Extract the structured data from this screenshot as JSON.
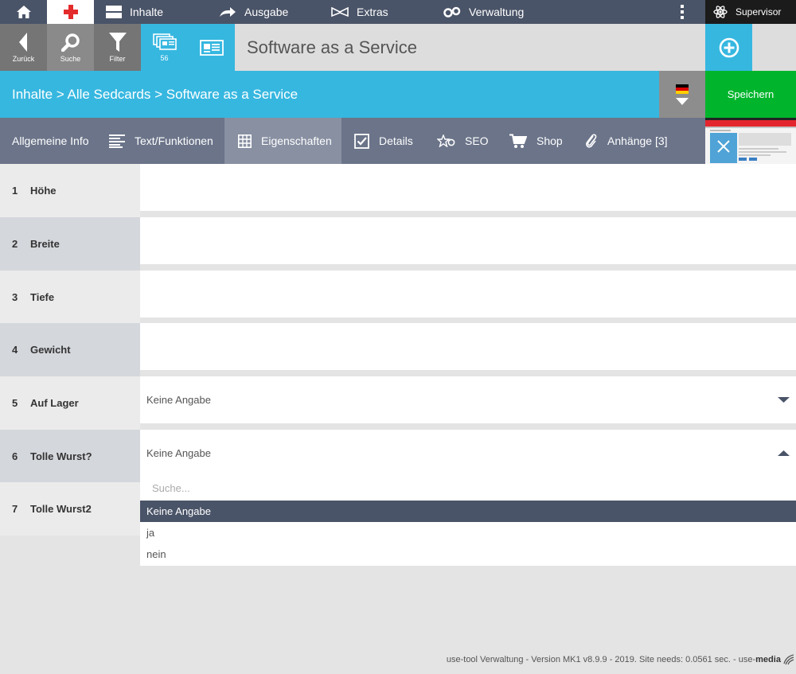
{
  "topnav": {
    "items": [
      {
        "label": "Inhalte",
        "icon": "content-icon"
      },
      {
        "label": "Ausgabe",
        "icon": "arrow-forward-icon"
      },
      {
        "label": "Extras",
        "icon": "extras-icon"
      },
      {
        "label": "Verwaltung",
        "icon": "gears-icon"
      }
    ],
    "user": "Supervisor"
  },
  "toolbar": {
    "back_caption": "Zurück",
    "search_caption": "Suche",
    "filter_caption": "Filter",
    "stack_count": "56",
    "title": "Software as a Service"
  },
  "breadcrumb": "Inhalte > Alle Sedcards > Software as a Service",
  "save_label": "Speichern",
  "tabs": [
    {
      "label": "Allgemeine Info"
    },
    {
      "label": "Text/Funktionen"
    },
    {
      "label": "Eigenschaften"
    },
    {
      "label": "Details"
    },
    {
      "label": "SEO"
    },
    {
      "label": "Shop"
    },
    {
      "label": "Anhänge [3]"
    }
  ],
  "properties": [
    {
      "num": "1",
      "label": "Höhe"
    },
    {
      "num": "2",
      "label": "Breite"
    },
    {
      "num": "3",
      "label": "Tiefe"
    },
    {
      "num": "4",
      "label": "Gewicht"
    },
    {
      "num": "5",
      "label": "Auf Lager",
      "value": "Keine Angabe"
    },
    {
      "num": "6",
      "label": "Tolle Wurst?",
      "value": "Keine Angabe"
    },
    {
      "num": "7",
      "label": "Tolle Wurst2"
    }
  ],
  "dropdown": {
    "search_placeholder": "Suche...",
    "options": [
      "Keine Angabe",
      "ja",
      "nein"
    ],
    "selected": "Keine Angabe"
  },
  "footer": {
    "text": "use-tool Verwaltung - Version MK1 v8.9.9 - 2019. Site needs: 0.0561 sec. - use-",
    "brand": "media"
  },
  "colors": {
    "nav": "#4a5468",
    "accent": "#36b7e0",
    "save": "#00b52c",
    "tabbar": "#6b7489",
    "active_tab": "#8890a2"
  }
}
